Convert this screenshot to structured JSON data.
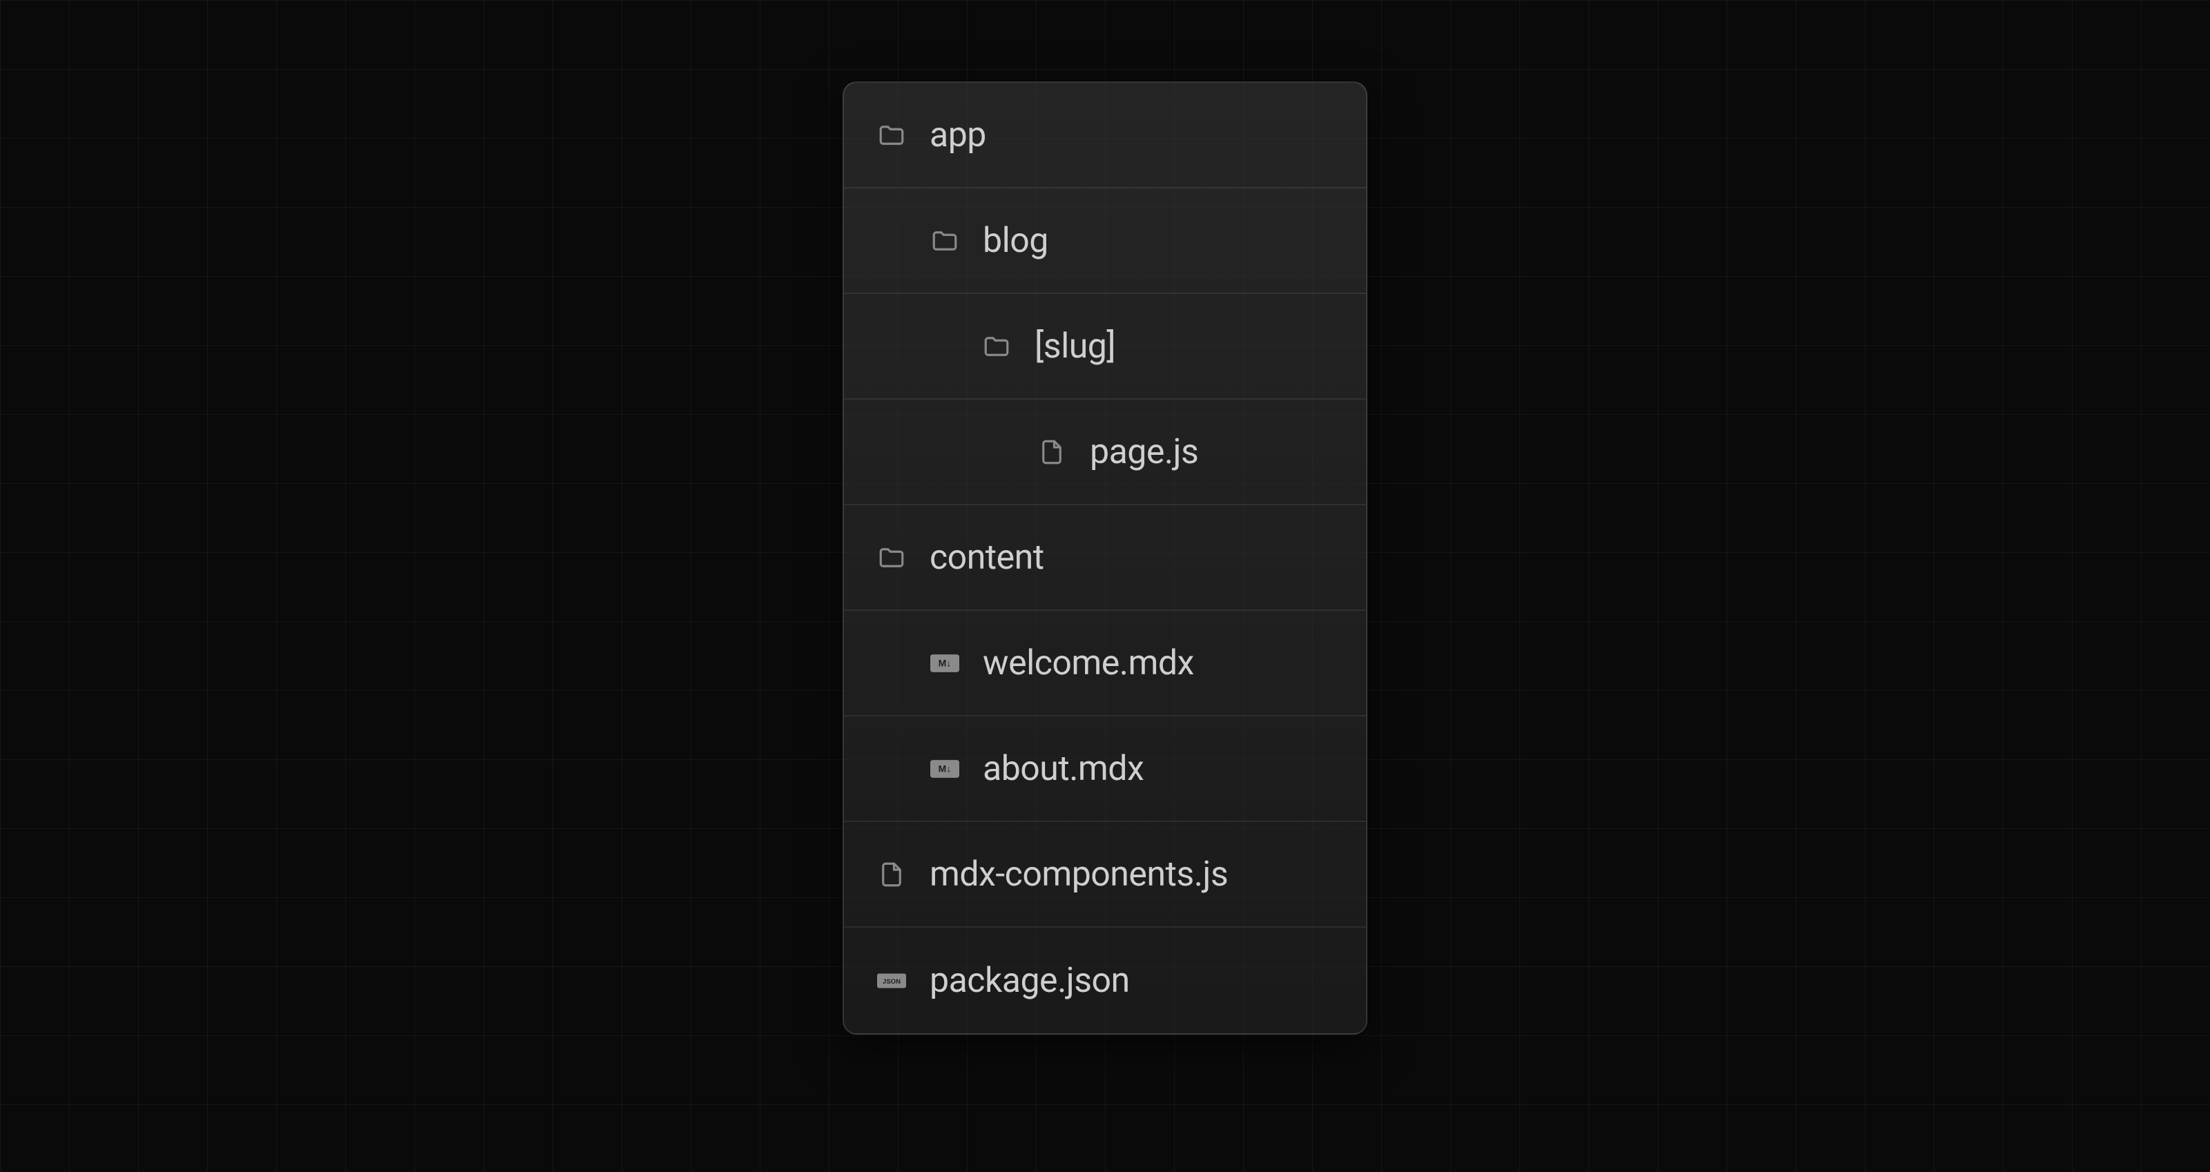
{
  "tree": {
    "items": [
      {
        "label": "app",
        "depth": 0,
        "icon": "folder",
        "name": "folder-app"
      },
      {
        "label": "blog",
        "depth": 1,
        "icon": "folder",
        "name": "folder-blog"
      },
      {
        "label": "[slug]",
        "depth": 2,
        "icon": "folder",
        "name": "folder-slug"
      },
      {
        "label": "page.js",
        "depth": 3,
        "icon": "file",
        "name": "file-page-js"
      },
      {
        "label": "content",
        "depth": 0,
        "icon": "folder",
        "name": "folder-content"
      },
      {
        "label": "welcome.mdx",
        "depth": 1,
        "icon": "mdx",
        "name": "file-welcome-mdx"
      },
      {
        "label": "about.mdx",
        "depth": 1,
        "icon": "mdx",
        "name": "file-about-mdx"
      },
      {
        "label": "mdx-components.js",
        "depth": 0,
        "icon": "file",
        "name": "file-mdx-components-js"
      },
      {
        "label": "package.json",
        "depth": 0,
        "icon": "json",
        "name": "file-package-json"
      }
    ]
  }
}
